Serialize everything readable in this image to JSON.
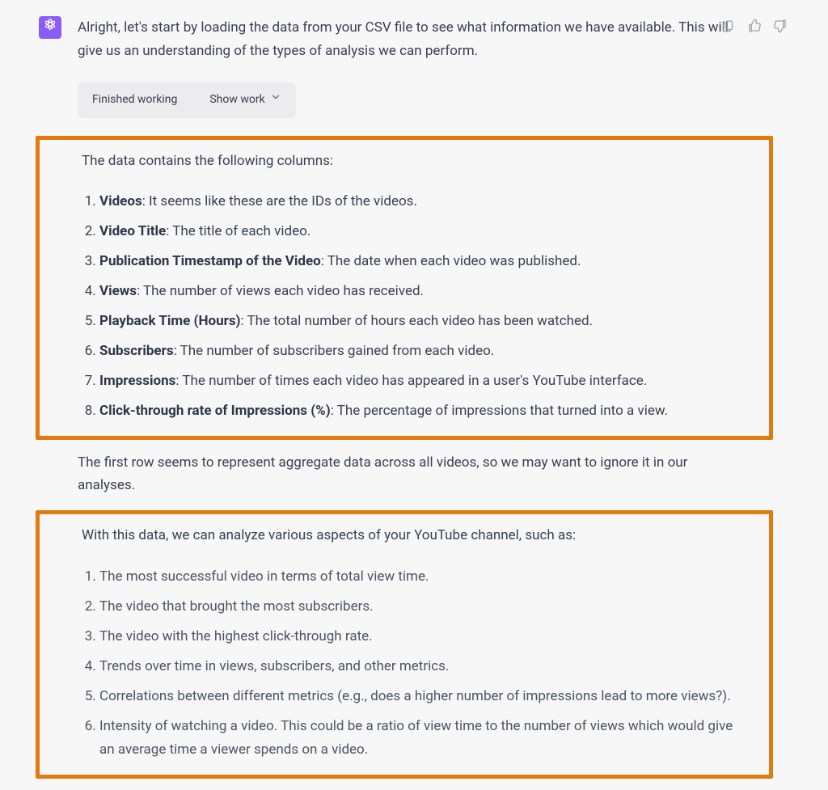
{
  "message": {
    "intro": "Alright, let's start by loading the data from your CSV file to see what information we have available. This will give us an understanding of the types of analysis we can perform.",
    "work_pill": {
      "status": "Finished working",
      "toggle": "Show work"
    },
    "columns_intro": "The data contains the following columns:",
    "columns": [
      {
        "term": "Videos",
        "desc": ": It seems like these are the IDs of the videos."
      },
      {
        "term": "Video Title",
        "desc": ": The title of each video."
      },
      {
        "term": "Publication Timestamp of the Video",
        "desc": ": The date when each video was published."
      },
      {
        "term": "Views",
        "desc": ": The number of views each video has received."
      },
      {
        "term": "Playback Time (Hours)",
        "desc": ": The total number of hours each video has been watched."
      },
      {
        "term": "Subscribers",
        "desc": ": The number of subscribers gained from each video."
      },
      {
        "term": "Impressions",
        "desc": ": The number of times each video has appeared in a user's YouTube interface."
      },
      {
        "term": "Click-through rate of Impressions (%)",
        "desc": ": The percentage of impressions that turned into a view."
      }
    ],
    "between_note": "The first row seems to represent aggregate data across all videos, so we may want to ignore it in our analyses.",
    "analysis_intro": "With this data, we can analyze various aspects of your YouTube channel, such as:",
    "analysis_items": [
      "The most successful video in terms of total view time.",
      "The video that brought the most subscribers.",
      "The video with the highest click-through rate.",
      "Trends over time in views, subscribers, and other metrics.",
      "Correlations between different metrics (e.g., does a higher number of impressions lead to more views?).",
      "Intensity of watching a video. This could be a ratio of view time to the number of views which would give an average time a viewer spends on a video."
    ]
  },
  "icons": {
    "assistant": "assistant-icon",
    "copy": "copy-icon",
    "thumbs_up": "thumbs-up-icon",
    "thumbs_down": "thumbs-down-icon",
    "chevron_down": "chevron-down-icon"
  }
}
